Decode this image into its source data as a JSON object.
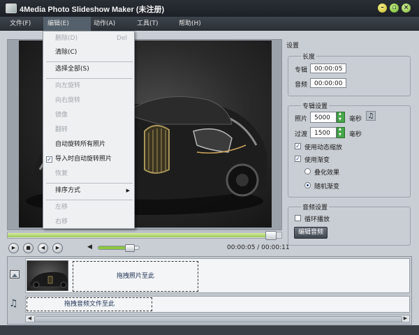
{
  "window": {
    "title": "4Media Photo Slideshow Maker (未注册)"
  },
  "menubar": [
    {
      "label": "文件(F)"
    },
    {
      "label": "编辑(E)"
    },
    {
      "label": "动作(A)"
    },
    {
      "label": "工具(T)"
    },
    {
      "label": "帮助(H)"
    }
  ],
  "edit_menu": {
    "delete": {
      "label": "删除(D)",
      "shortcut": "Del"
    },
    "clear": {
      "label": "清除(C)"
    },
    "select_all": {
      "label": "选择全部(S)"
    },
    "rotate_left": {
      "label": "向左旋转"
    },
    "rotate_right": {
      "label": "向右旋转"
    },
    "mirror": {
      "label": "镜像"
    },
    "flip": {
      "label": "翻转"
    },
    "auto_rotate_all": {
      "label": "自动旋转所有照片"
    },
    "auto_rotate_import": {
      "label": "导入时自动旋转照片",
      "checked": true
    },
    "restore": {
      "label": "恢复"
    },
    "sort": {
      "label": "排序方式"
    },
    "move_left": {
      "label": "左移"
    },
    "move_right": {
      "label": "右移"
    }
  },
  "player": {
    "progress_fraction": 0.96,
    "volume_fraction": 0.75,
    "time": "00:00:05 / 00:00:11"
  },
  "settings": {
    "title": "设置",
    "length": {
      "title": "长度",
      "album_label": "专辑",
      "album_value": "00:00:05",
      "audio_label": "音频",
      "audio_value": "00:00:00"
    },
    "album_settings": {
      "title": "专辑设置",
      "photo_label": "照片",
      "photo_value": "5000",
      "photo_unit": "毫秒",
      "transition_label": "过渡",
      "transition_value": "1500",
      "transition_unit": "毫秒",
      "dynamic_zoom": "使用动态缩放",
      "dynamic_zoom_checked": true,
      "use_transition": "使用渐变",
      "use_transition_checked": true,
      "overlay_effect": "叠化效果",
      "random_transition": "随机渐变",
      "selected_transition": "random"
    },
    "audio_settings": {
      "title": "音频设置",
      "loop": "循环播放",
      "loop_checked": false,
      "edit_audio": "编辑音频"
    }
  },
  "timeline": {
    "photo_drop": "拖拽照片至此",
    "audio_drop": "拖拽音频文件至此"
  },
  "colors": {
    "accent_green": "#8cc63f",
    "title_bar": "#1c2026",
    "panel_bg": "#c9ced4"
  }
}
